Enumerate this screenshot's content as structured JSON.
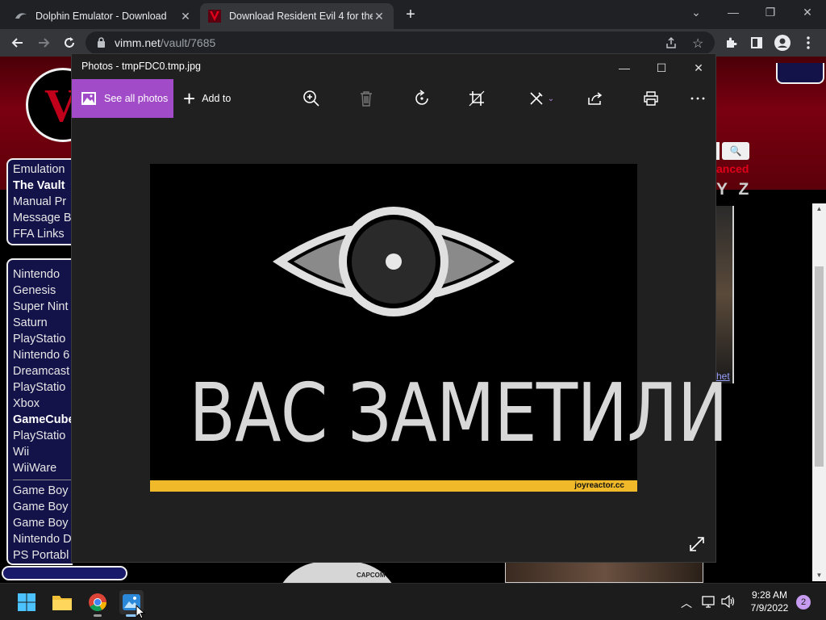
{
  "browser": {
    "tabs": [
      {
        "label": "Dolphin Emulator - Download",
        "icon": "dolphin-icon"
      },
      {
        "label": "Download Resident Evil 4 for the",
        "icon": "vimm-icon"
      }
    ],
    "url_domain": "vimm.net",
    "url_path": "/vault/7685"
  },
  "webpage": {
    "nav_group1": [
      "Emulation",
      "The Vault",
      "Manual Pr",
      "Message B",
      "FFA Links"
    ],
    "nav_group2": [
      "Nintendo",
      "Genesis",
      "Super Nint",
      "Saturn",
      "PlayStatio",
      "Nintendo 6",
      "Dreamcast",
      "PlayStatio",
      "Xbox",
      "GameCube",
      "PlayStatio",
      "Wii",
      "WiiWare"
    ],
    "nav_group3": [
      "Game Boy",
      "Game Boy",
      "Game Boy",
      "Nintendo D",
      "PS Portabl"
    ],
    "advanced_link": "anced",
    "letters": "Y Z",
    "thumb_link": "het",
    "disc_label": "CAPCOM"
  },
  "photos": {
    "window_title": "Photos - tmpFDC0.tmp.jpg",
    "see_all": "See all photos",
    "add_to": "Add to",
    "image_caption": "ВАС ЗАМЕТИЛИ",
    "watermark": "joyreactor.cc"
  },
  "taskbar": {
    "time": "9:28 AM",
    "date": "7/9/2022",
    "notifications": "2"
  }
}
